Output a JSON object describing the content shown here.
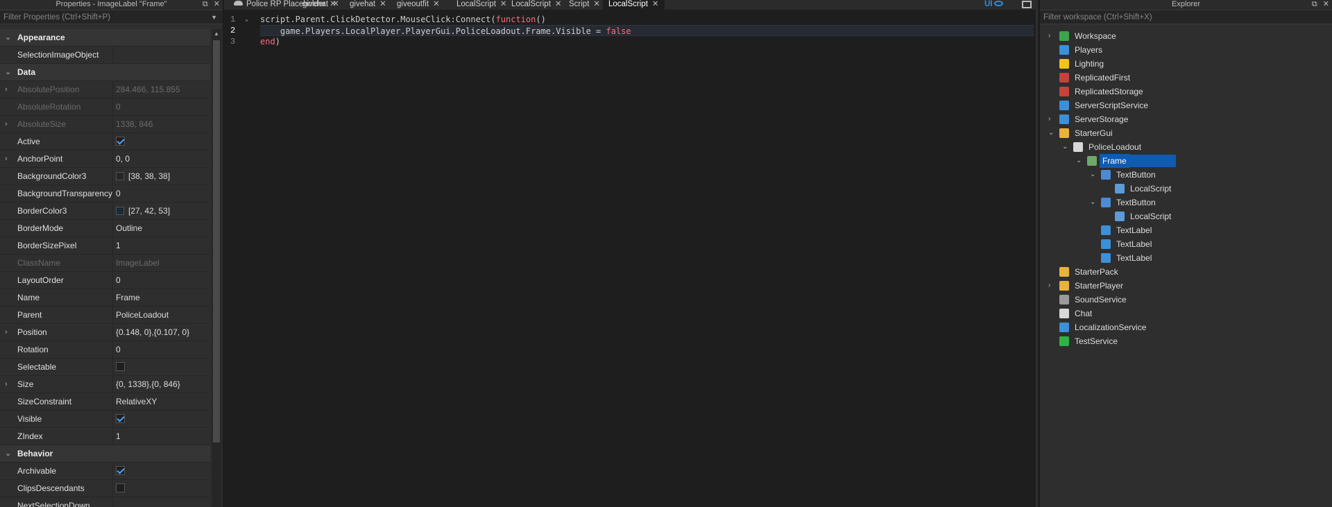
{
  "properties": {
    "title": "Properties - ImageLabel \"Frame\"",
    "filter_placeholder": "Filter Properties (Ctrl+Shift+P)",
    "window_buttons": [
      "⧉",
      "✕"
    ],
    "rows": [
      {
        "kind": "section",
        "label": "Appearance"
      },
      {
        "kind": "prop",
        "name": "SelectionImageObject",
        "value": ""
      },
      {
        "kind": "section",
        "label": "Data"
      },
      {
        "kind": "prop",
        "name": "AbsolutePosition",
        "value": "284.466, 115.855",
        "disabled": true,
        "expandable": true
      },
      {
        "kind": "prop",
        "name": "AbsoluteRotation",
        "value": "0",
        "disabled": true
      },
      {
        "kind": "prop",
        "name": "AbsoluteSize",
        "value": "1338, 846",
        "disabled": true,
        "expandable": true
      },
      {
        "kind": "prop",
        "name": "Active",
        "checkbox": true,
        "checked": true
      },
      {
        "kind": "prop",
        "name": "AnchorPoint",
        "value": "0, 0",
        "expandable": true
      },
      {
        "kind": "prop",
        "name": "BackgroundColor3",
        "value": "[38, 38, 38]",
        "color": "#262626"
      },
      {
        "kind": "prop",
        "name": "BackgroundTransparency",
        "value": "0"
      },
      {
        "kind": "prop",
        "name": "BorderColor3",
        "value": "[27, 42, 53]",
        "color": "#1b2a35"
      },
      {
        "kind": "prop",
        "name": "BorderMode",
        "value": "Outline"
      },
      {
        "kind": "prop",
        "name": "BorderSizePixel",
        "value": "1"
      },
      {
        "kind": "prop",
        "name": "ClassName",
        "value": "ImageLabel",
        "disabled": true
      },
      {
        "kind": "prop",
        "name": "LayoutOrder",
        "value": "0"
      },
      {
        "kind": "prop",
        "name": "Name",
        "value": "Frame"
      },
      {
        "kind": "prop",
        "name": "Parent",
        "value": "PoliceLoadout"
      },
      {
        "kind": "prop",
        "name": "Position",
        "value": "{0.148, 0},{0.107, 0}",
        "expandable": true
      },
      {
        "kind": "prop",
        "name": "Rotation",
        "value": "0"
      },
      {
        "kind": "prop",
        "name": "Selectable",
        "checkbox": true,
        "checked": false
      },
      {
        "kind": "prop",
        "name": "Size",
        "value": "{0, 1338},{0, 846}",
        "expandable": true
      },
      {
        "kind": "prop",
        "name": "SizeConstraint",
        "value": "RelativeXY"
      },
      {
        "kind": "prop",
        "name": "Visible",
        "checkbox": true,
        "checked": true
      },
      {
        "kind": "prop",
        "name": "ZIndex",
        "value": "1"
      },
      {
        "kind": "section",
        "label": "Behavior"
      },
      {
        "kind": "prop",
        "name": "Archivable",
        "checkbox": true,
        "checked": true
      },
      {
        "kind": "prop",
        "name": "ClipsDescendants",
        "checkbox": true,
        "checked": false
      },
      {
        "kind": "prop",
        "name": "NextSelectionDown",
        "value": ""
      }
    ]
  },
  "editor": {
    "tabs": [
      {
        "label": "Police RP Placeholder",
        "cloud": true
      },
      {
        "label": "givehat"
      },
      {
        "label": "givehat"
      },
      {
        "label": "giveoutfit"
      },
      {
        "label": "LocalScript"
      },
      {
        "label": "LocalScript"
      },
      {
        "label": "Script"
      },
      {
        "label": "LocalScript",
        "active": true
      }
    ],
    "close_glyph": "✕",
    "ui_toggle_label": "UI",
    "line_numbers": [
      "1",
      "2",
      "3"
    ],
    "code": {
      "l1a": "script.Parent.ClickDetector.MouseClick:Connect(",
      "l1kw": "function",
      "l1b": "()",
      "l2a": "    game.Players.LocalPlayer.PlayerGui.PoliceLoadout.Frame.Visible = ",
      "l2kw": "false",
      "l3kw": "end",
      "l3b": ")"
    },
    "colors": {
      "keyword": "#f86d7c",
      "text": "#cccccc"
    }
  },
  "explorer": {
    "title": "Explorer",
    "filter_placeholder": "Filter workspace (Ctrl+Shift+X)",
    "window_buttons": [
      "⧉",
      "✕"
    ],
    "items": [
      {
        "label": "Workspace",
        "depth": 0,
        "arrow": "›",
        "icon": "globe-icon",
        "color": "#3fa34d"
      },
      {
        "label": "Players",
        "depth": 0,
        "arrow": "",
        "icon": "players-icon",
        "color": "#3d8fd8"
      },
      {
        "label": "Lighting",
        "depth": 0,
        "arrow": "",
        "icon": "lightbulb-icon",
        "color": "#f0c419"
      },
      {
        "label": "ReplicatedFirst",
        "depth": 0,
        "arrow": "",
        "icon": "replicated-first-icon",
        "color": "#c8423b"
      },
      {
        "label": "ReplicatedStorage",
        "depth": 0,
        "arrow": "",
        "icon": "replicated-storage-icon",
        "color": "#c8423b"
      },
      {
        "label": "ServerScriptService",
        "depth": 0,
        "arrow": "",
        "icon": "server-script-service-icon",
        "color": "#3d8fd8"
      },
      {
        "label": "ServerStorage",
        "depth": 0,
        "arrow": "›",
        "icon": "server-storage-icon",
        "color": "#3d8fd8"
      },
      {
        "label": "StarterGui",
        "depth": 0,
        "arrow": "⌄",
        "icon": "starter-gui-icon",
        "color": "#e8b33b"
      },
      {
        "label": "PoliceLoadout",
        "depth": 1,
        "arrow": "⌄",
        "icon": "screengui-icon",
        "color": "#d8d8d8"
      },
      {
        "label": "Frame",
        "depth": 2,
        "arrow": "⌄",
        "icon": "image-label-icon",
        "color": "#6fa86a",
        "selected": true
      },
      {
        "label": "TextButton",
        "depth": 3,
        "arrow": "⌄",
        "icon": "text-button-icon",
        "color": "#4b8bd6"
      },
      {
        "label": "LocalScript",
        "depth": 4,
        "arrow": "",
        "icon": "local-script-icon",
        "color": "#5b9bd8"
      },
      {
        "label": "TextButton",
        "depth": 3,
        "arrow": "⌄",
        "icon": "text-button-icon",
        "color": "#4b8bd6"
      },
      {
        "label": "LocalScript",
        "depth": 4,
        "arrow": "",
        "icon": "local-script-icon",
        "color": "#5b9bd8"
      },
      {
        "label": "TextLabel",
        "depth": 3,
        "arrow": "",
        "icon": "text-label-icon",
        "color": "#3d8fd8"
      },
      {
        "label": "TextLabel",
        "depth": 3,
        "arrow": "",
        "icon": "text-label-icon",
        "color": "#3d8fd8"
      },
      {
        "label": "TextLabel",
        "depth": 3,
        "arrow": "",
        "icon": "text-label-icon",
        "color": "#3d8fd8"
      },
      {
        "label": "StarterPack",
        "depth": 0,
        "arrow": "",
        "icon": "starter-pack-icon",
        "color": "#e8b33b"
      },
      {
        "label": "StarterPlayer",
        "depth": 0,
        "arrow": "›",
        "icon": "starter-player-icon",
        "color": "#e8b33b"
      },
      {
        "label": "SoundService",
        "depth": 0,
        "arrow": "",
        "icon": "sound-service-icon",
        "color": "#9a9a9a"
      },
      {
        "label": "Chat",
        "depth": 0,
        "arrow": "",
        "icon": "chat-icon",
        "color": "#d8d8d8"
      },
      {
        "label": "LocalizationService",
        "depth": 0,
        "arrow": "",
        "icon": "localization-service-icon",
        "color": "#3d8fd8"
      },
      {
        "label": "TestService",
        "depth": 0,
        "arrow": "",
        "icon": "test-service-icon",
        "color": "#2fb14a"
      }
    ],
    "selection_color": "#0f5bb0"
  }
}
